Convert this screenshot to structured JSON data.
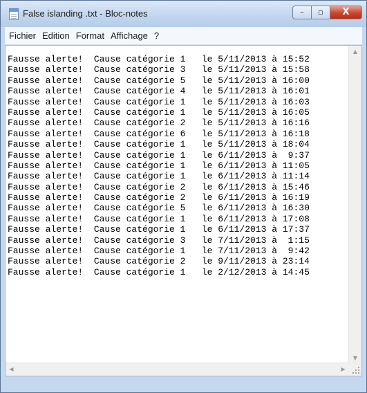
{
  "window": {
    "title": "False islanding .txt - Bloc-notes",
    "buttons": {
      "minimize": "–",
      "maximize": "▫",
      "close": "X"
    }
  },
  "menu": {
    "items": [
      "Fichier",
      "Edition",
      "Format",
      "Affichage",
      "?"
    ]
  },
  "document": {
    "lines": [
      "Fausse alerte!  Cause catégorie 1   le 5/11/2013 à 15:52",
      "Fausse alerte!  Cause catégorie 3   le 5/11/2013 à 15:58",
      "Fausse alerte!  Cause catégorie 5   le 5/11/2013 à 16:00",
      "Fausse alerte!  Cause catégorie 4   le 5/11/2013 à 16:01",
      "Fausse alerte!  Cause catégorie 1   le 5/11/2013 à 16:03",
      "Fausse alerte!  Cause catégorie 1   le 5/11/2013 à 16:05",
      "Fausse alerte!  Cause catégorie 2   le 5/11/2013 à 16:16",
      "Fausse alerte!  Cause catégorie 6   le 5/11/2013 à 16:18",
      "Fausse alerte!  Cause catégorie 1   le 5/11/2013 à 18:04",
      "Fausse alerte!  Cause catégorie 1   le 6/11/2013 à  9:37",
      "Fausse alerte!  Cause catégorie 1   le 6/11/2013 à 11:05",
      "Fausse alerte!  Cause catégorie 1   le 6/11/2013 à 11:14",
      "Fausse alerte!  Cause catégorie 2   le 6/11/2013 à 15:46",
      "Fausse alerte!  Cause catégorie 2   le 6/11/2013 à 16:19",
      "Fausse alerte!  Cause catégorie 5   le 6/11/2013 à 16:30",
      "Fausse alerte!  Cause catégorie 1   le 6/11/2013 à 17:08",
      "Fausse alerte!  Cause catégorie 1   le 6/11/2013 à 17:37",
      "Fausse alerte!  Cause catégorie 3   le 7/11/2013 à  1:15",
      "Fausse alerte!  Cause catégorie 1   le 7/11/2013 à  9:42",
      "Fausse alerte!  Cause catégorie 2   le 9/11/2013 à 23:14",
      "Fausse alerte!  Cause catégorie 1   le 2/12/2013 à 14:45"
    ]
  },
  "icons": {
    "app": "notepad-icon",
    "scroll_up": "arrow-up-icon",
    "scroll_down": "arrow-down-icon",
    "scroll_left": "arrow-left-icon",
    "scroll_right": "arrow-right-icon",
    "grip": "size-grip-icon"
  },
  "colors": {
    "frame": "#c4d9ef",
    "close_button": "#c9452e",
    "text": "#000000"
  }
}
